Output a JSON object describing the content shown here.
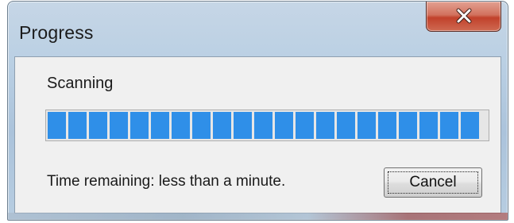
{
  "window": {
    "title": "Progress",
    "close_icon": "close-x-icon"
  },
  "content": {
    "status_label": "Scanning",
    "progress": {
      "segments_filled": 21,
      "percent": 100,
      "color": "#2f8fe8"
    },
    "time_remaining": "Time remaining: less than a minute.",
    "cancel_label": "Cancel"
  }
}
